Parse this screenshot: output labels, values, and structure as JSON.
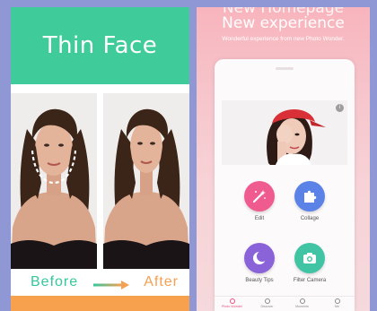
{
  "left_panel": {
    "title": "Thin Face",
    "before_label": "Before",
    "after_label": "After",
    "colors": {
      "header": "#3fcb9a",
      "before": "#36c79b",
      "after": "#f5a052",
      "footer": "#f7a04e"
    }
  },
  "right_panel": {
    "headline_cut": "New Homepage",
    "headline": "New experience",
    "tagline": "Wonderful experience from new Photo Wonder.",
    "banner_info_icon": "i",
    "tiles": [
      {
        "label": "Edit",
        "icon": "magic-wand-icon",
        "color": "#ef5b8e"
      },
      {
        "label": "Collage",
        "icon": "puzzle-icon",
        "color": "#5b82e6"
      },
      {
        "label": "Beauty Tips",
        "icon": "moon-icon",
        "color": "#8a63d9"
      },
      {
        "label": "Filter Camera",
        "icon": "camera-icon",
        "color": "#41c4a4"
      }
    ],
    "tabs": [
      {
        "label": "Photo Wonder",
        "icon": "wand-tab-icon",
        "active": true
      },
      {
        "label": "Discover",
        "icon": "eye-icon",
        "active": false
      },
      {
        "label": "Moments",
        "icon": "globe-icon",
        "active": false
      },
      {
        "label": "Me",
        "icon": "person-icon",
        "active": false
      }
    ]
  }
}
